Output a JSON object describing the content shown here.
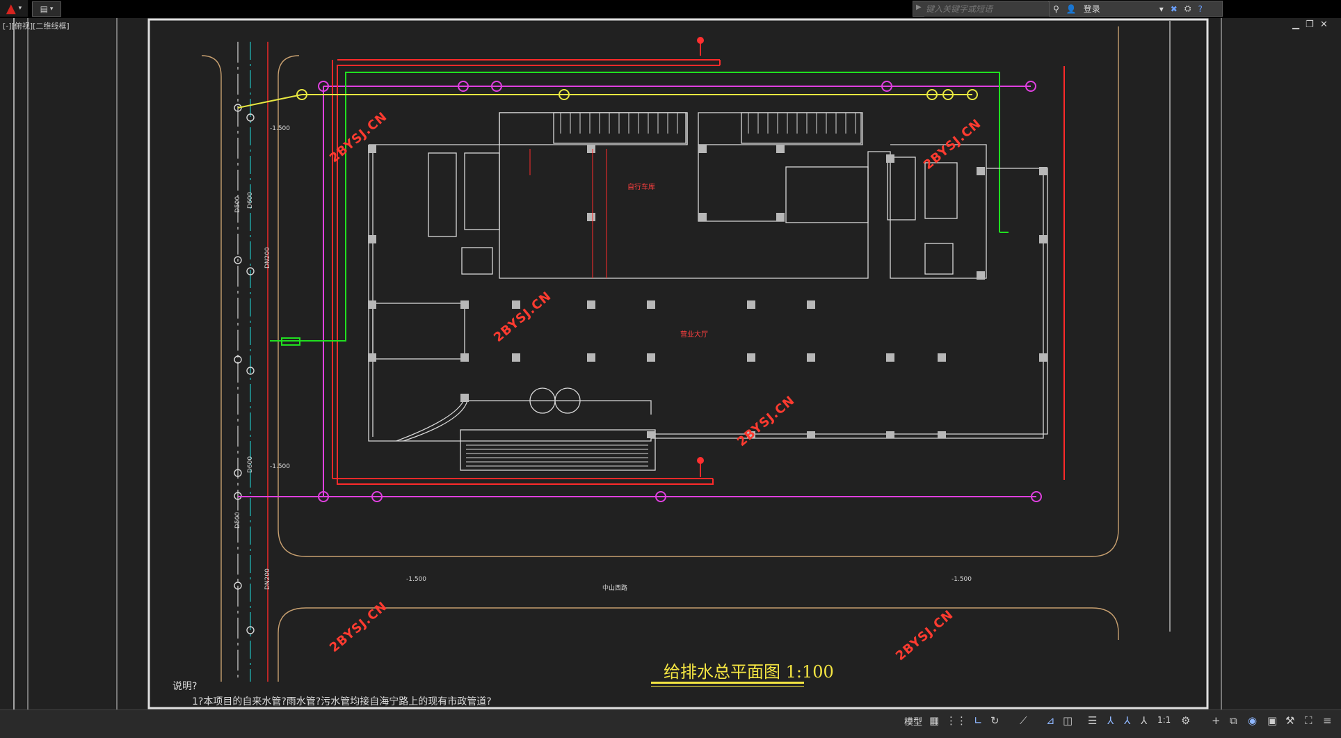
{
  "titlebar": {
    "search_placeholder": "键入关键字或短语",
    "login_label": "登录"
  },
  "viewport": {
    "label": "[-][俯视][二维线框]"
  },
  "drawing": {
    "title": "给排水总平面图  1:100",
    "notes_heading": "说明?",
    "notes_line1": "1?本项目的自来水管?雨水管?污水管均接自海宁路上的现有市政管道?",
    "watermark": "2BYSJ.CN",
    "elev_label": "-1.500",
    "d600": "D600",
    "d500": "D500",
    "dn200": "DN200",
    "labels": {
      "hall": "营业大厅",
      "garage": "自行车库",
      "road": "中山西路"
    }
  },
  "statusbar": {
    "model_label": "模型",
    "scale_label": "1:1"
  },
  "colors": {
    "magenta": "#e040e0",
    "red": "#ff2a2a",
    "green": "#20e020",
    "yellow": "#e8e840",
    "white": "#d8d8d8",
    "tan": "#c8a070",
    "cyan": "#20c0c0"
  }
}
